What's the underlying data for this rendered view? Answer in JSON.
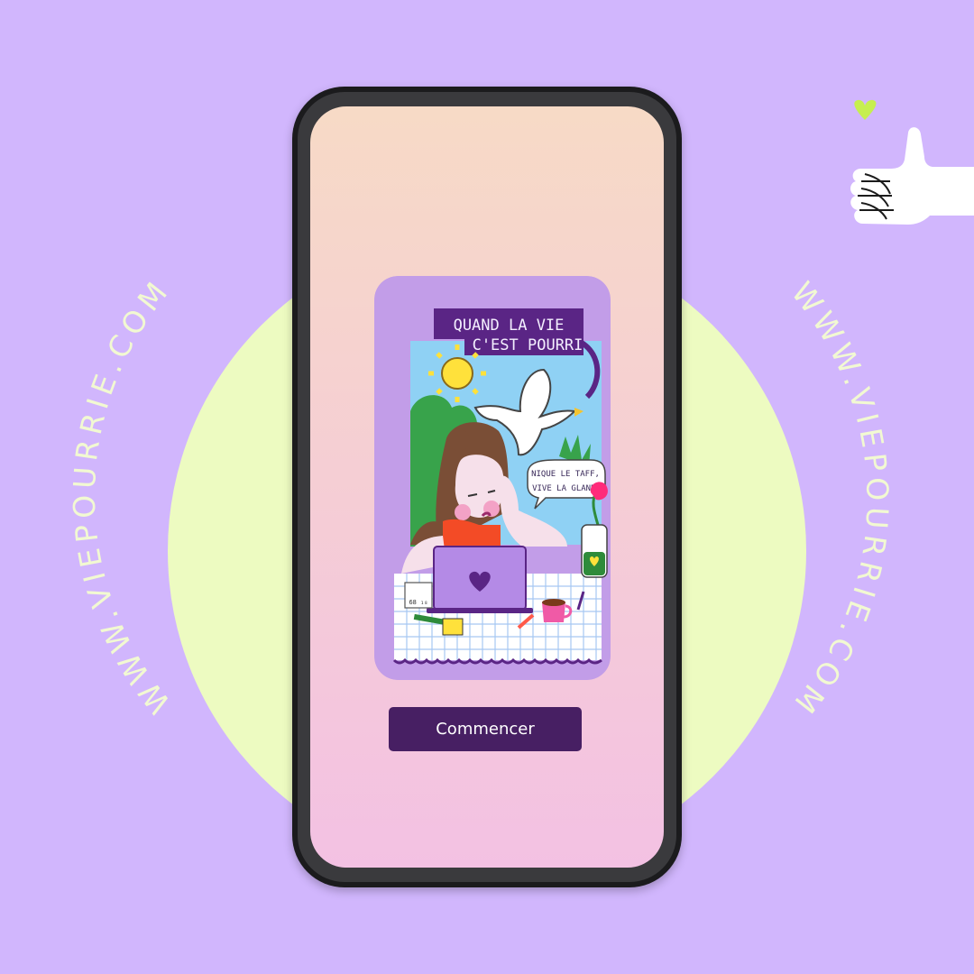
{
  "colors": {
    "background": "#d1b6fd",
    "circle": "#edfbc1",
    "circle_text": "#f2f9d2",
    "screen_top": "#f7dac6",
    "screen_bottom": "#f3c1e3",
    "card": "#c29de8",
    "button": "#471f63",
    "button_text": "#ffffff",
    "heart": "#c6ef4f"
  },
  "watermark": {
    "left": "WWW.VIEPOURRIE.COM",
    "right": "WWW.VIEPOURRIE.COM"
  },
  "card": {
    "title_line1": "QUAND LA VIE",
    "title_line2": "C'EST POURRI",
    "bubble_line1": "NIQUE LE TAFF,",
    "bubble_line2": "VIVE LA GLANDE",
    "note": "68 ₁₈"
  },
  "app": {
    "start_button": "Commencer"
  },
  "icons": {
    "thumb": "thumbs-up-icon",
    "heart": "heart-icon"
  }
}
